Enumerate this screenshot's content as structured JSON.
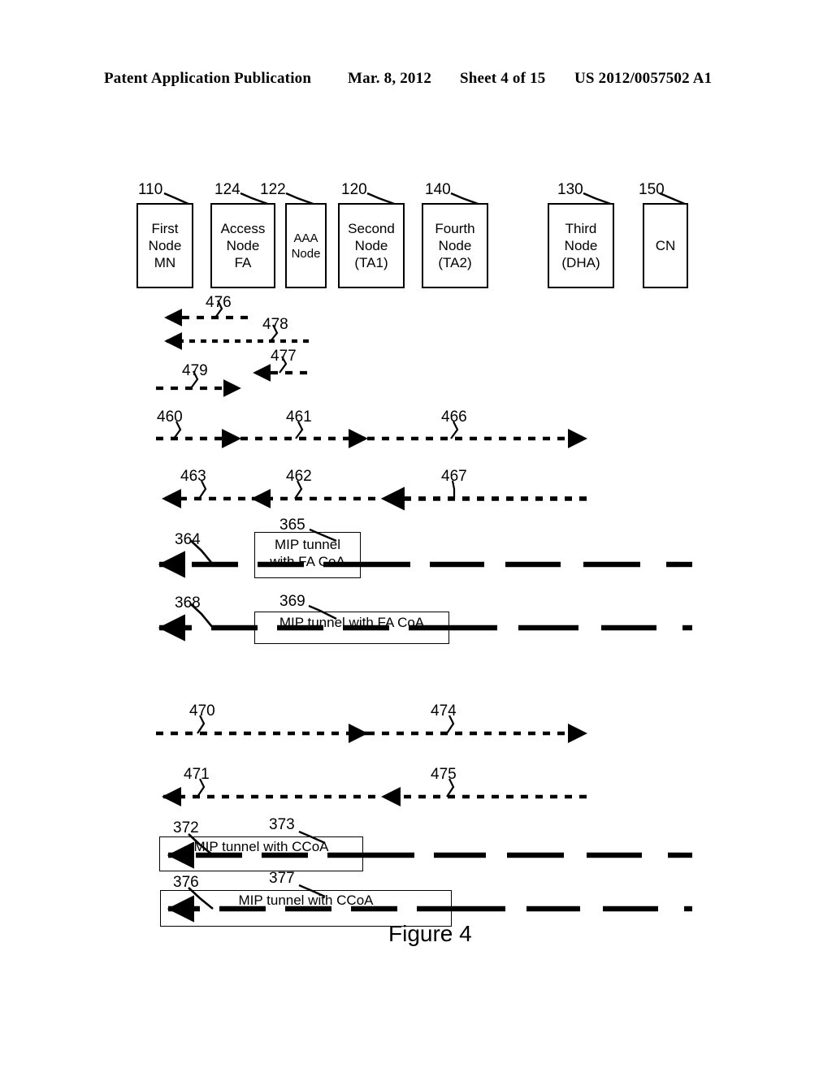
{
  "header": {
    "title": "Patent Application Publication",
    "date": "Mar. 8, 2012",
    "sheet": "Sheet 4 of 15",
    "publication_number": "US 2012/0057502 A1"
  },
  "figure": {
    "caption": "Figure 4"
  },
  "nodes": [
    {
      "ref": "110",
      "lines": [
        "First",
        "Node",
        "MN"
      ]
    },
    {
      "ref": "124",
      "lines": [
        "Access",
        "Node",
        "FA"
      ]
    },
    {
      "ref": "122",
      "lines": [
        "AAA",
        "Node"
      ]
    },
    {
      "ref": "120",
      "lines": [
        "Second",
        "Node",
        "(TA1)"
      ]
    },
    {
      "ref": "140",
      "lines": [
        "Fourth",
        "Node",
        "(TA2)"
      ]
    },
    {
      "ref": "130",
      "lines": [
        "Third",
        "Node",
        "(DHA)"
      ]
    },
    {
      "ref": "150",
      "lines": [
        "CN"
      ]
    }
  ],
  "message_refs": [
    {
      "id": "476"
    },
    {
      "id": "478"
    },
    {
      "id": "477"
    },
    {
      "id": "479"
    },
    {
      "id": "460"
    },
    {
      "id": "461"
    },
    {
      "id": "466"
    },
    {
      "id": "463"
    },
    {
      "id": "462"
    },
    {
      "id": "467"
    },
    {
      "id": "364"
    },
    {
      "id": "365"
    },
    {
      "id": "368"
    },
    {
      "id": "369"
    },
    {
      "id": "470"
    },
    {
      "id": "474"
    },
    {
      "id": "471"
    },
    {
      "id": "475"
    },
    {
      "id": "372"
    },
    {
      "id": "373"
    },
    {
      "id": "376"
    },
    {
      "id": "377"
    }
  ],
  "tunnels": [
    {
      "ref": "365",
      "lines": [
        "MIP tunnel",
        "with FA CoA"
      ]
    },
    {
      "ref": "369",
      "lines": [
        "MIP tunnel with FA CoA"
      ]
    },
    {
      "ref": "373",
      "lines": [
        "MIP tunnel with CCoA"
      ]
    },
    {
      "ref": "377",
      "lines": [
        "MIP tunnel with CCoA"
      ]
    }
  ],
  "colors": {
    "ink": "#000000",
    "paper": "#ffffff"
  }
}
